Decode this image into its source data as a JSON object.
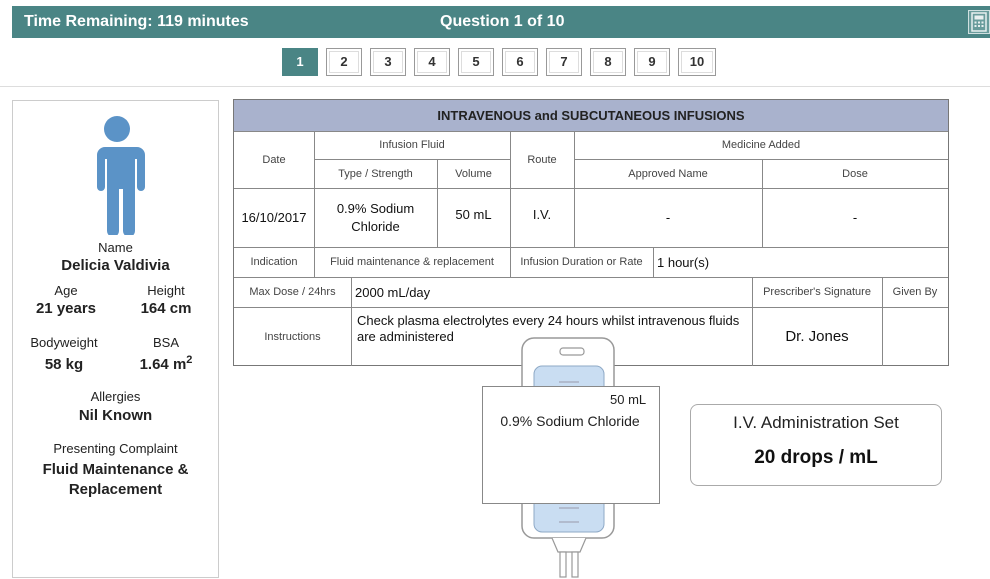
{
  "header": {
    "time_remaining": "Time Remaining: 119 minutes",
    "question": "Question 1 of 10",
    "calculator_icon": "calculator-icon",
    "bar_color": "#4a8585"
  },
  "question_nav": {
    "buttons": [
      "1",
      "2",
      "3",
      "4",
      "5",
      "6",
      "7",
      "8",
      "9",
      "10"
    ],
    "active": "1"
  },
  "patient": {
    "icon": "person-icon",
    "name_label": "Name",
    "name": "Delicia Valdivia",
    "age_label": "Age",
    "age": "21 years",
    "height_label": "Height",
    "height": "164 cm",
    "bodyweight_label": "Bodyweight",
    "bodyweight": "58 kg",
    "bsa_label": "BSA",
    "bsa": "1.64 m",
    "bsa_sup": "2",
    "allergies_label": "Allergies",
    "allergies": "Nil Known",
    "complaint_label": "Presenting Complaint",
    "complaint_line1": "Fluid Maintenance &",
    "complaint_line2": "Replacement"
  },
  "prescription": {
    "title": "INTRAVENOUS and SUBCUTANEOUS INFUSIONS",
    "headers": {
      "date": "Date",
      "infusion_fluid": "Infusion Fluid",
      "type_strength": "Type / Strength",
      "volume": "Volume",
      "route": "Route",
      "medicine_added": "Medicine Added",
      "approved_name": "Approved Name",
      "dose": "Dose"
    },
    "row": {
      "date": "16/10/2017",
      "fluid": "0.9% Sodium Chloride",
      "volume": "50 mL",
      "route": "I.V.",
      "approved_name": "-",
      "dose": "-"
    },
    "indication_label": "Indication",
    "indication": "Fluid maintenance & replacement",
    "duration_label": "Infusion Duration or Rate",
    "duration": "1 hour(s)",
    "max_dose_label": "Max Dose / 24hrs",
    "max_dose": "2000 mL/day",
    "prescriber_label": "Prescriber's Signature",
    "given_by_label": "Given By",
    "instructions_label": "Instructions",
    "instructions": "Check plasma electrolytes every 24 hours whilst intravenous fluids are administered",
    "prescriber": "Dr. Jones"
  },
  "iv_bag": {
    "volume": "50 mL",
    "fluid": "0.9% Sodium Chloride",
    "fill_color": "#c9ddf2"
  },
  "admin_set": {
    "title": "I.V. Administration Set",
    "rate": "20 drops / mL"
  }
}
